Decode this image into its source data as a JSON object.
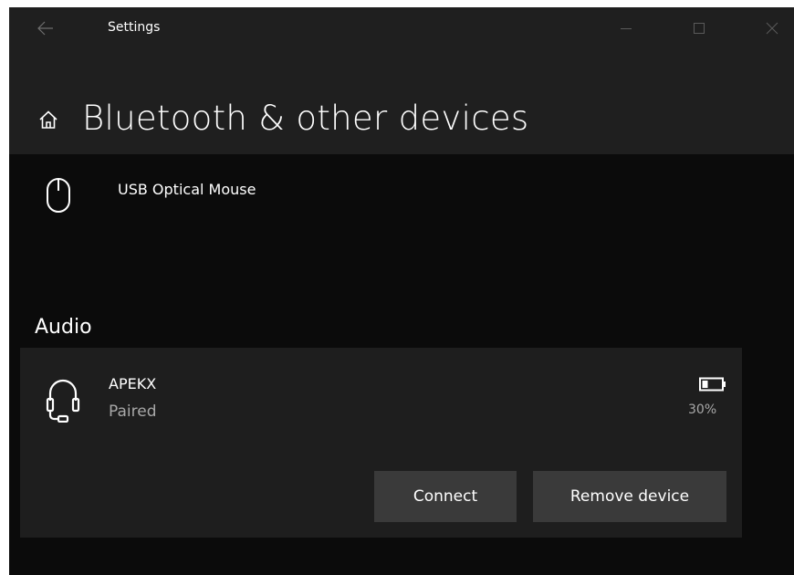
{
  "window": {
    "title": "Settings"
  },
  "titlebar": {
    "back_icon": "back-arrow-icon",
    "minimize_icon": "minimize-icon",
    "maximize_icon": "maximize-icon",
    "close_icon": "close-icon"
  },
  "header": {
    "home_icon": "home-icon",
    "title": "Bluetooth & other devices"
  },
  "devices": {
    "mouse": {
      "icon": "mouse-icon",
      "name": "USB Optical Mouse"
    }
  },
  "audio": {
    "heading": "Audio",
    "device": {
      "icon": "headset-icon",
      "name": "APEKX",
      "status": "Paired",
      "battery_icon": "battery-icon",
      "battery_level": 30,
      "battery_text": "30%"
    },
    "buttons": {
      "connect_label": "Connect",
      "remove_label": "Remove device"
    }
  },
  "colors": {
    "background": "#0b0b0b",
    "header_background": "#1f1f1f",
    "card_background": "#1e1e1e",
    "button_background": "#3a3a3a",
    "secondary_text": "#a8a8a8"
  }
}
